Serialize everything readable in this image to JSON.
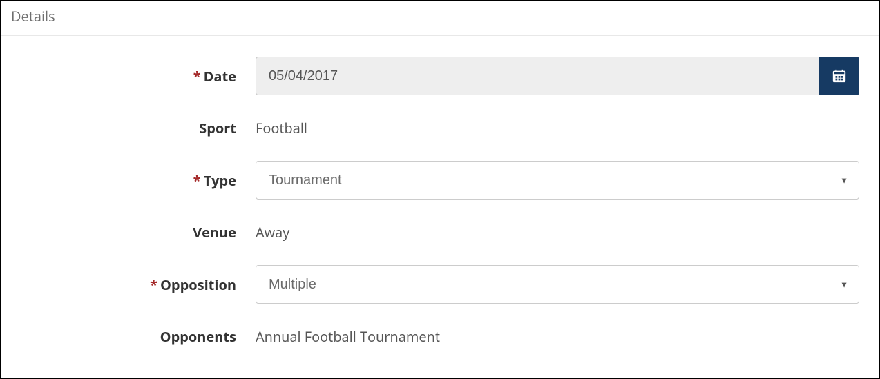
{
  "panel": {
    "title": "Details"
  },
  "required_mark": "*",
  "labels": {
    "date": "Date",
    "sport": "Sport",
    "type": "Type",
    "venue": "Venue",
    "opposition": "Opposition",
    "opponents": "Opponents"
  },
  "values": {
    "date": "05/04/2017",
    "sport": "Football",
    "type_selected": "Tournament",
    "venue": "Away",
    "opposition_selected": "Multiple",
    "opponents": "Annual Football Tournament"
  },
  "options": {
    "type": [
      "Tournament"
    ],
    "opposition": [
      "Multiple"
    ]
  },
  "caret": "▼"
}
